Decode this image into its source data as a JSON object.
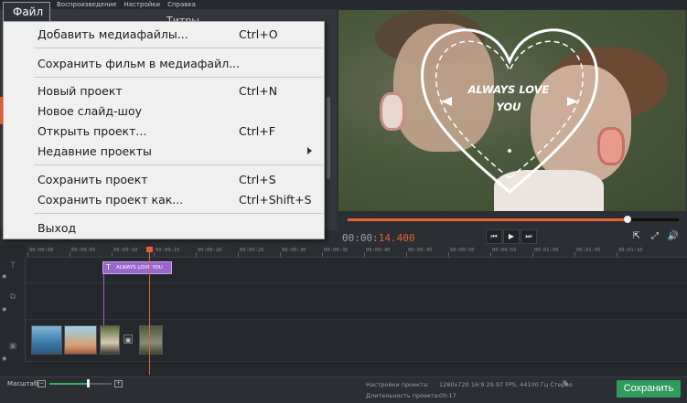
{
  "menu": {
    "file": "Файл",
    "items_rest": [
      "Воспроизведение",
      "Настройки",
      "Справка"
    ]
  },
  "left_panel": {
    "title": "Титры"
  },
  "file_menu": {
    "items": [
      {
        "label": "Добавить медиафайлы...",
        "shortcut": "Ctrl+O"
      },
      {
        "label": "Сохранить фильм в медиафайл...",
        "shortcut": ""
      },
      {
        "label": "Новый проект",
        "shortcut": "Ctrl+N"
      },
      {
        "label": "Новое слайд-шоу",
        "shortcut": ""
      },
      {
        "label": "Открыть проект...",
        "shortcut": "Ctrl+F"
      },
      {
        "label": "Недавние проекты",
        "shortcut": "",
        "submenu": true
      },
      {
        "label": "Сохранить проект",
        "shortcut": "Ctrl+S"
      },
      {
        "label": "Сохранить проект как...",
        "shortcut": "Ctrl+Shift+S"
      },
      {
        "label": "Выход",
        "shortcut": ""
      }
    ]
  },
  "preview": {
    "caption": "ALWAYS LOVE YOU"
  },
  "player": {
    "timecode_elapsed": "00:00:",
    "timecode_accent": "14.400",
    "progress": 0.846,
    "controls": [
      "prev-frame-button",
      "play-button",
      "next-frame-button"
    ]
  },
  "timeline": {
    "ticks": [
      "00:00:00",
      "00:00:05",
      "00:00:10",
      "00:00:15",
      "00:00:20",
      "00:00:25",
      "00:00:30",
      "00:00:35",
      "00:00:40",
      "00:00:45",
      "00:00:50",
      "00:00:55",
      "00:01:00",
      "00:01:05",
      "00:01:10"
    ],
    "title_clip": "ALWAYS LOVE YOU"
  },
  "bottom": {
    "zoom_label": "Масштаб:",
    "zoom_level": 0.62,
    "project_settings_label": "Настройки проекта:",
    "project_settings_value": "1280x720 16:9 29.97 FPS, 44100 Гц Стерео",
    "duration_label": "Длительность проекта:",
    "duration_value": "00:17",
    "save_button": "Сохранить"
  },
  "colors": {
    "accent": "#e5603a",
    "save_green": "#2f9a5c",
    "title_clip": "#9966cc"
  }
}
